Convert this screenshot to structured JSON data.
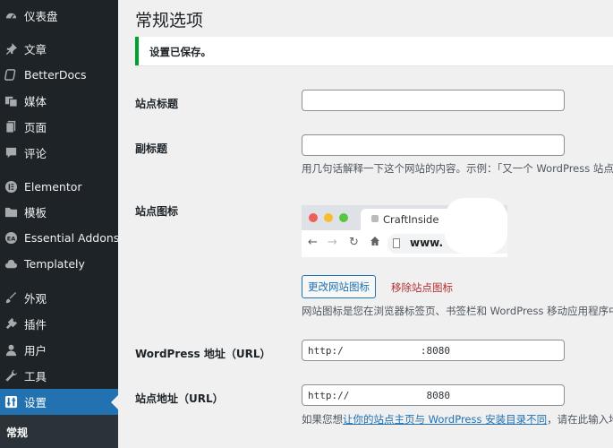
{
  "sidebar": {
    "items": [
      {
        "label": "仪表盘",
        "icon": "dashboard-icon"
      },
      {
        "label": "文章",
        "icon": "pin-icon"
      },
      {
        "label": "BetterDocs",
        "icon": "docs-icon"
      },
      {
        "label": "媒体",
        "icon": "media-icon"
      },
      {
        "label": "页面",
        "icon": "page-icon"
      },
      {
        "label": "评论",
        "icon": "comment-icon"
      },
      {
        "label": "Elementor",
        "icon": "elementor-icon"
      },
      {
        "label": "模板",
        "icon": "folder-icon"
      },
      {
        "label": "Essential Addons",
        "icon": "ea-icon"
      },
      {
        "label": "Templately",
        "icon": "cloud-icon"
      },
      {
        "label": "外观",
        "icon": "brush-icon"
      },
      {
        "label": "插件",
        "icon": "plugin-icon"
      },
      {
        "label": "用户",
        "icon": "user-icon"
      },
      {
        "label": "工具",
        "icon": "wrench-icon"
      },
      {
        "label": "设置",
        "icon": "settings-icon"
      }
    ],
    "submenu_current": "常规"
  },
  "page": {
    "title": "常规选项",
    "notice": "设置已保存。"
  },
  "fields": {
    "site_title_label": "站点标题",
    "site_title_value": "",
    "tagline_label": "副标题",
    "tagline_value": "",
    "tagline_desc": "用几句话解释一下这个网站的内容。示例：「又一个 WordPress 站点",
    "site_icon_label": "站点图标",
    "site_icon_tab_title": "CraftInside",
    "site_icon_url": "www.",
    "change_icon_button": "更改网站图标",
    "remove_icon_link": "移除站点图标",
    "site_icon_desc": "网站图标是您在浏览器标签页、书签栏和 WordPress 移动应用程序中",
    "wp_address_label": "WordPress 地址（URL）",
    "wp_address_value": "http:/             :8080",
    "site_address_label": "站点地址（URL）",
    "site_address_value": "http://             8080",
    "site_address_desc_prefix": "如果您想",
    "site_address_desc_link": "让你的站点主页与 WordPress 安装目录不同",
    "site_address_desc_suffix": "，请在此输入地"
  }
}
